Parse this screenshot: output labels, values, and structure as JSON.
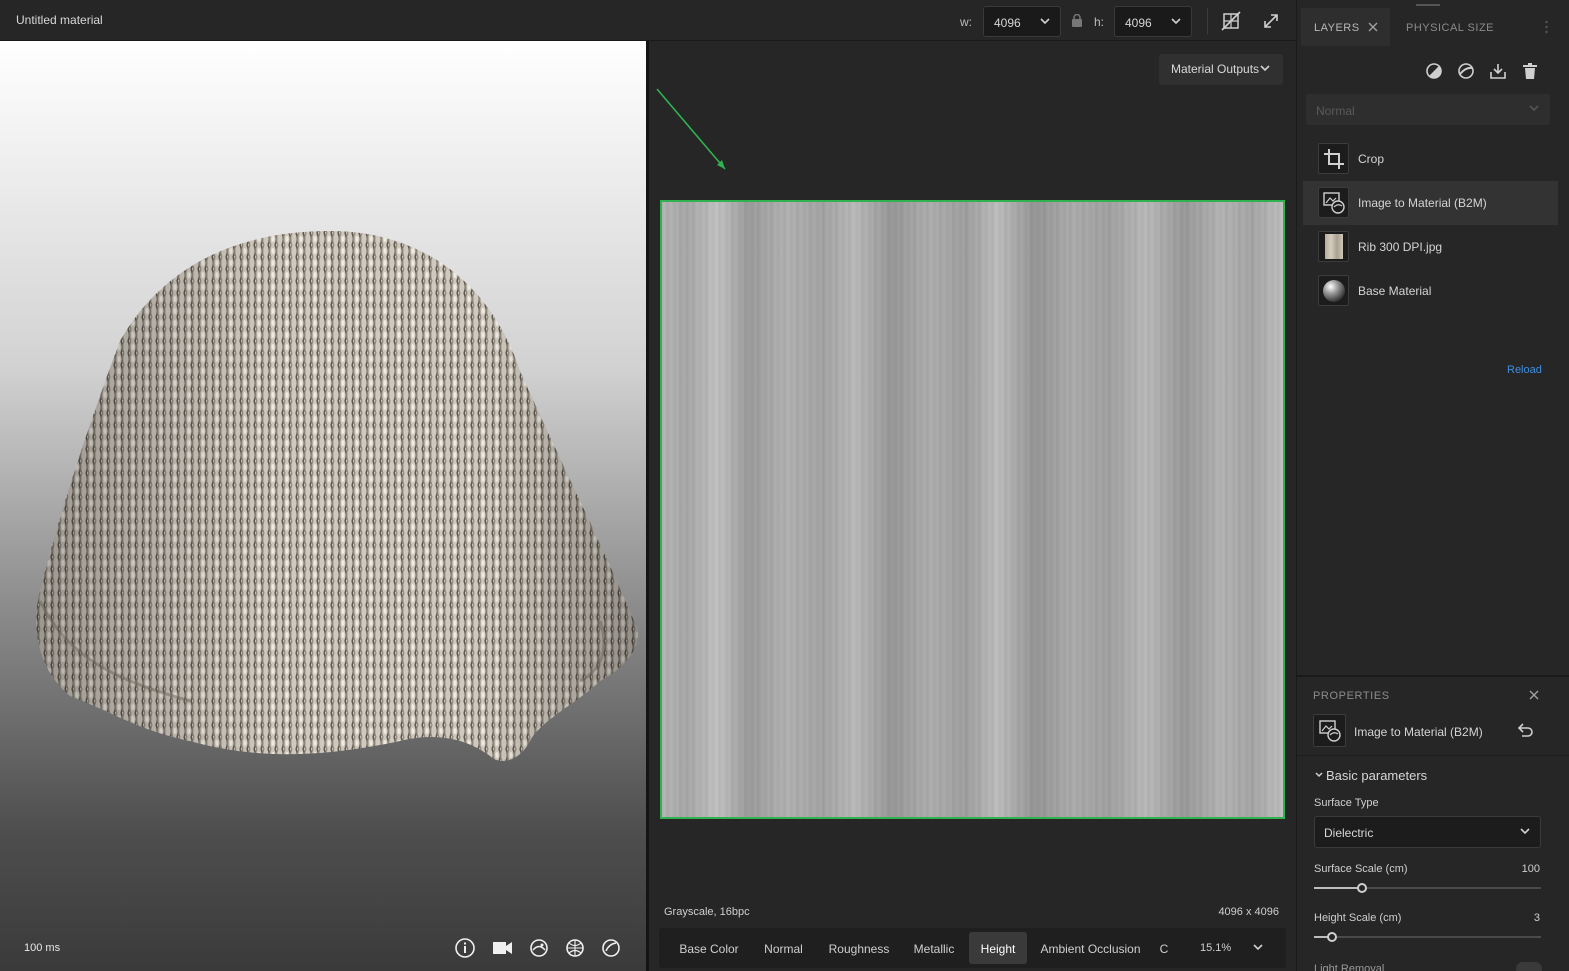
{
  "header": {
    "title": "Untitled material",
    "width_label": "w:",
    "width_value": "4096",
    "height_label": "h:",
    "height_value": "4096"
  },
  "viewport3d": {
    "timing": "100 ms"
  },
  "view2d": {
    "outputs_label": "Material Outputs",
    "format_info": "Grayscale, 16bpc",
    "resolution_info": "4096 x 4096",
    "channels": [
      {
        "label": "Base Color",
        "active": false
      },
      {
        "label": "Normal",
        "active": false
      },
      {
        "label": "Roughness",
        "active": false
      },
      {
        "label": "Metallic",
        "active": false
      },
      {
        "label": "Height",
        "active": true
      },
      {
        "label": "Ambient Occlusion",
        "active": false
      },
      {
        "label": "C",
        "active": false
      }
    ],
    "zoom": "15.1%"
  },
  "layers_panel": {
    "tabs": [
      {
        "label": "LAYERS",
        "active": true
      },
      {
        "label": "PHYSICAL SIZE",
        "active": false
      }
    ],
    "blend_mode": "Normal",
    "items": [
      {
        "label": "Crop",
        "icon": "crop-icon",
        "selected": false
      },
      {
        "label": "Image to Material (B2M)",
        "icon": "image-to-material-icon",
        "selected": true
      },
      {
        "label": "Rib 300 DPI.jpg",
        "icon": "image-thumbnail",
        "selected": false
      },
      {
        "label": "Base Material",
        "icon": "sphere-icon",
        "selected": false
      }
    ],
    "reload_label": "Reload"
  },
  "properties_panel": {
    "title": "PROPERTIES",
    "layer_name": "Image to Material (B2M)",
    "section": "Basic parameters",
    "surface_type_label": "Surface Type",
    "surface_type_value": "Dielectric",
    "surface_scale_label": "Surface Scale (cm)",
    "surface_scale_value": "100",
    "surface_scale_fraction": 0.21,
    "height_scale_label": "Height Scale (cm)",
    "height_scale_value": "3",
    "height_scale_fraction": 0.08,
    "next_label": "Light Removal"
  },
  "colors": {
    "accent_green": "#2fb24f",
    "link_blue": "#3d8ee0"
  }
}
